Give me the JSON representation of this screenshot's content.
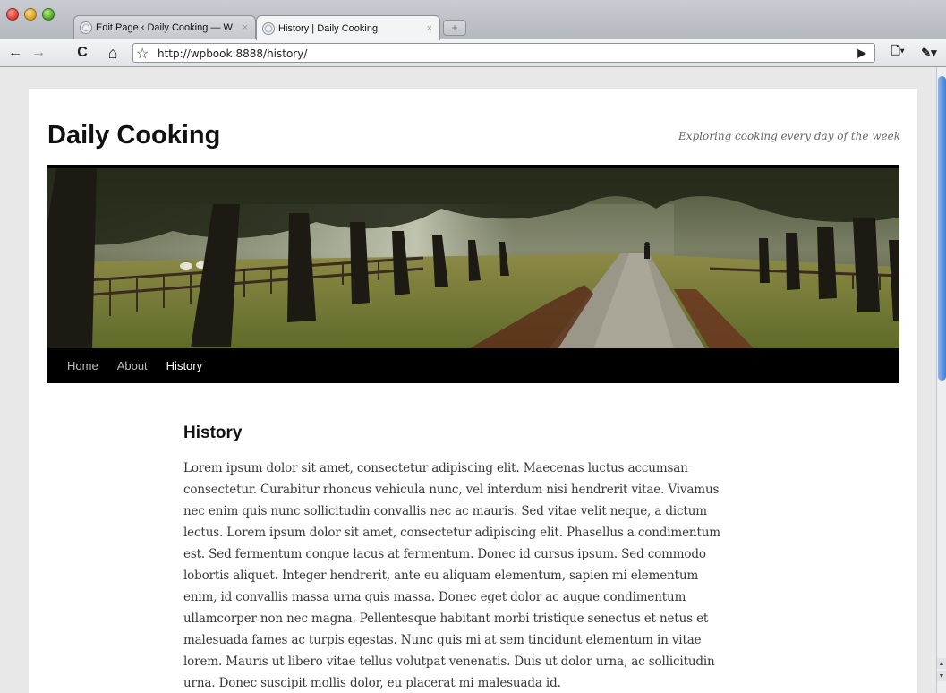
{
  "browser": {
    "tabs": [
      {
        "title": "Edit Page ‹ Daily Cooking — W",
        "active": false
      },
      {
        "title": "History | Daily Cooking",
        "active": true
      }
    ],
    "close_glyph": "×",
    "new_tab_glyph": "+",
    "url": "http://wpbook:8888/history/",
    "buttons": {
      "back": "←",
      "forward": "→",
      "reload": "C",
      "home": "⌂",
      "bookmark": "☆",
      "go": "▶",
      "page_menu": "🗋▾",
      "tools_menu": "✎▾"
    }
  },
  "site": {
    "title": "Daily Cooking",
    "tagline": "Exploring cooking every day of the week",
    "banner_icon": "tree-lined-path-image",
    "nav": [
      "Home",
      "About",
      "History"
    ],
    "current_nav": "History"
  },
  "entry": {
    "title": "History",
    "lines": [
      "Lorem ipsum dolor sit amet, consectetur adipiscing elit. Maecenas luctus accumsan",
      "consectetur. Curabitur rhoncus vehicula nunc, vel interdum nisi hendrerit vitae. Vivamus",
      "nec enim quis nunc sollicitudin convallis nec ac mauris. Sed vitae velit neque, a dictum",
      "lectus. Lorem ipsum dolor sit amet, consectetur adipiscing elit. Phasellus a condimentum",
      "est. Sed fermentum congue lacus at fermentum. Donec id cursus ipsum. Sed commodo",
      "lobortis aliquet. Integer hendrerit, ante eu aliquam elementum, sapien mi elementum",
      "enim, id convallis massa urna quis massa. Donec eget dolor ac augue condimentum",
      "ullamcorper non nec magna. Pellentesque habitant morbi tristique senectus et netus et",
      "malesuada fames ac turpis egestas. Nunc quis mi at sem tincidunt elementum in vitae",
      "lorem. Mauris ut libero vitae tellus volutpat venenatis. Duis ut dolor urna, ac sollicitudin",
      "urna. Donec suscipit mollis dolor, eu placerat mi malesuada id."
    ]
  }
}
